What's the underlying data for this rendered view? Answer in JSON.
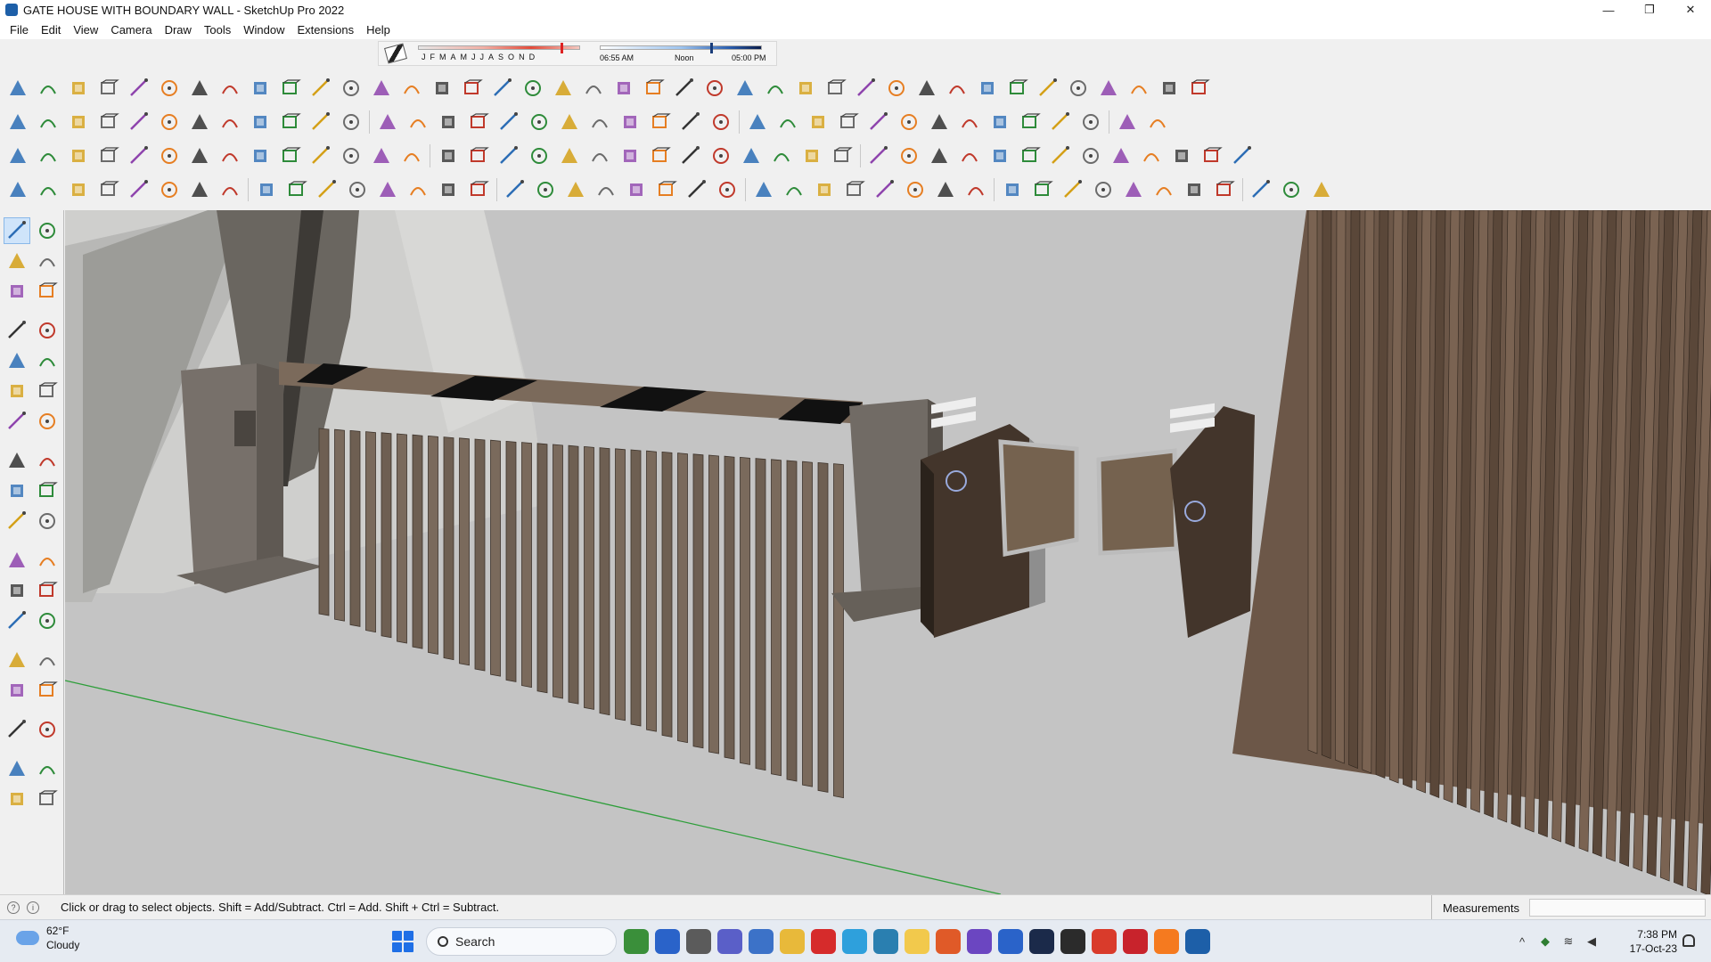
{
  "window": {
    "title": "GATE HOUSE WITH BOUNDARY WALL - SketchUp Pro 2022",
    "controls": [
      "—",
      "❐",
      "✕"
    ]
  },
  "menu": [
    "File",
    "Edit",
    "View",
    "Camera",
    "Draw",
    "Tools",
    "Window",
    "Extensions",
    "Help"
  ],
  "shadow_settings": {
    "months": [
      "J",
      "F",
      "M",
      "A",
      "M",
      "J",
      "J",
      "A",
      "S",
      "O",
      "N",
      "D"
    ],
    "time_labels": [
      "06:55 AM",
      "Noon",
      "05:00 PM"
    ]
  },
  "status": {
    "message": "Click or drag to select objects. Shift = Add/Subtract. Ctrl = Add. Shift + Ctrl = Subtract.",
    "measurements_label": "Measurements",
    "measurements_value": ""
  },
  "taskbar": {
    "weather_temp": "62°F",
    "weather_desc": "Cloudy",
    "search_placeholder": "Search",
    "time": "7:38 PM",
    "date": "17-Oct-23",
    "apps": [
      "widgets",
      "copilot",
      "task-view",
      "teams",
      "calculator",
      "file-explorer",
      "opera",
      "telegram",
      "sketchup-viewer",
      "sticky-notes",
      "garmin",
      "visual-studio",
      "app-3",
      "photoshop",
      "vectorworks",
      "chrome",
      "pinterest",
      "soundcloud",
      "sketchup"
    ]
  },
  "colors": {
    "accent": "#1f6fe6",
    "viewport_bg": "#c4c4c4",
    "axis_green": "#2e9e3a"
  }
}
